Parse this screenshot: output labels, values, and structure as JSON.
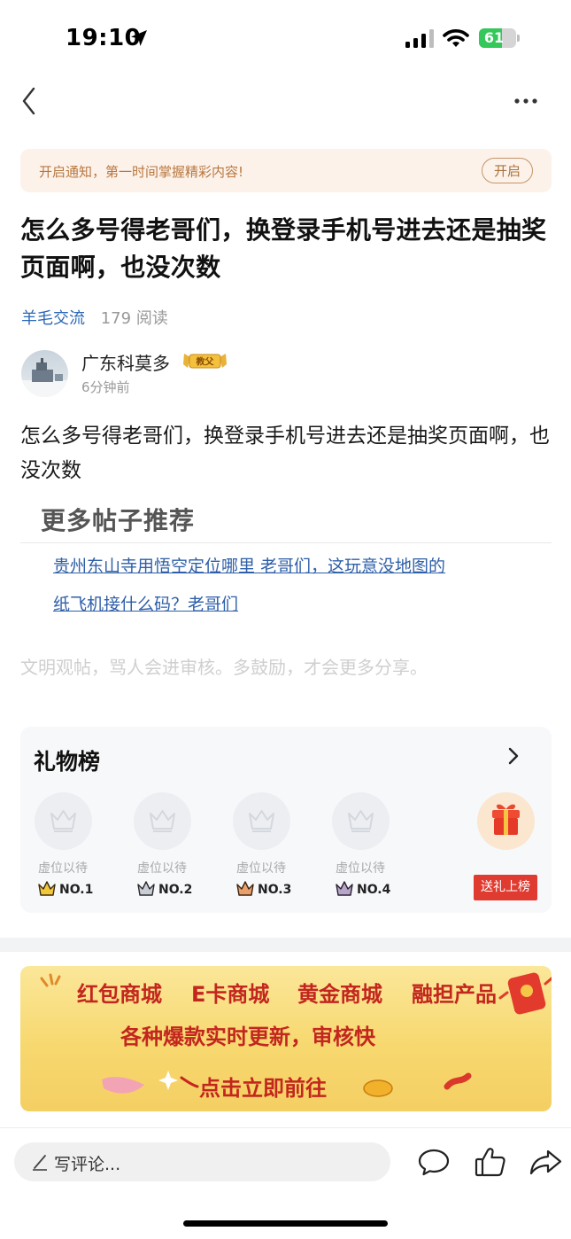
{
  "status_bar": {
    "time": "19:10",
    "battery": "61",
    "battery_level": 0.61
  },
  "notify": {
    "text": "开启通知，第一时间掌握精彩内容!",
    "button": "开启"
  },
  "post": {
    "title": "怎么多号得老哥们，换登录手机号进去还是抽奖页面啊，也没次数",
    "tag": "羊毛交流",
    "reads": "179 阅读",
    "author": "广东科莫多",
    "badge": "教父",
    "time": "6分钟前",
    "body": "怎么多号得老哥们，换登录手机号进去还是抽奖页面啊，也没次数"
  },
  "more_posts": {
    "heading": "更多帖子推荐",
    "links": [
      "贵州东山寺用悟空定位哪里 老哥们，这玩意没地图的",
      "纸飞机接什么码？老哥们"
    ]
  },
  "civil_notice": "文明观帖，骂人会进审核。多鼓励，才会更多分享。",
  "gift_board": {
    "title": "礼物榜",
    "slots": [
      {
        "label": "虚位以待",
        "rank": "NO.1"
      },
      {
        "label": "虚位以待",
        "rank": "NO.2"
      },
      {
        "label": "虚位以待",
        "rank": "NO.3"
      },
      {
        "label": "虚位以待",
        "rank": "NO.4"
      }
    ],
    "send_button": "送礼上榜"
  },
  "ad": {
    "items": [
      "红包商城",
      "E卡商城",
      "黄金商城",
      "融担产品"
    ],
    "line2": "各种爆款实时更新，审核快",
    "cta": "点击立即前往"
  },
  "bottom_bar": {
    "comment_placeholder": "写评论..."
  },
  "icons": [
    "location-arrow-icon",
    "signal-icon",
    "wifi-icon",
    "battery-icon",
    "back-icon",
    "more-icon",
    "crown-icon",
    "gift-icon",
    "pen-icon",
    "comment-icon",
    "like-icon",
    "share-icon"
  ],
  "colors": {
    "accent_link": "#2e5fa8",
    "tag": "#2c68b5",
    "notify_bg": "#fdf2ea",
    "gift_button": "#e03b30",
    "ad_text": "#c3261e"
  }
}
